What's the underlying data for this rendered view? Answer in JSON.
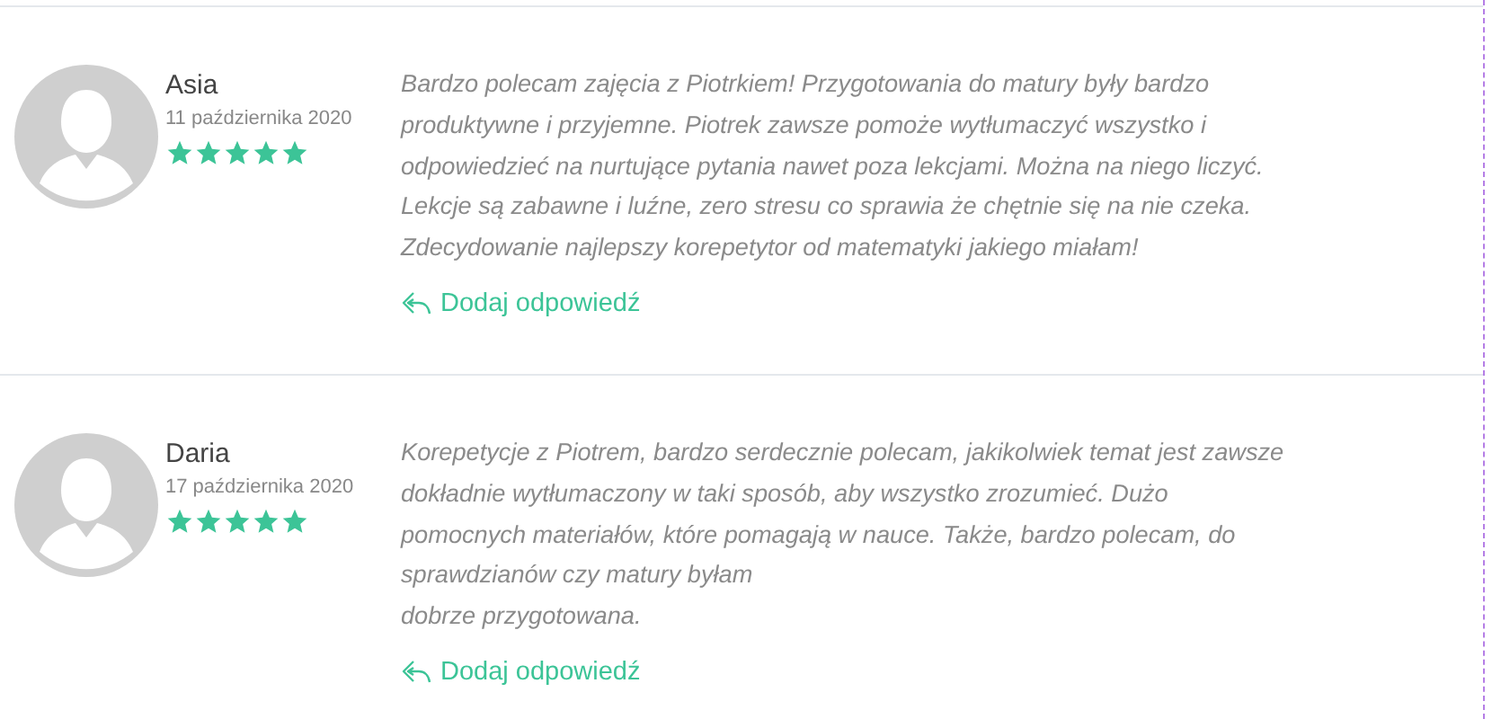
{
  "reviews": [
    {
      "name": "Asia",
      "date": "11 października 2020",
      "stars": 5,
      "text": "Bardzo polecam zajęcia z Piotrkiem! Przygotowania do matury były bardzo\nproduktywne i przyjemne. Piotrek zawsze pomoże wytłumaczyć wszystko i\nodpowiedzieć na nurtujące pytania nawet poza lekcjami. Można na niego liczyć.\nLekcje są zabawne i luźne, zero stresu co sprawia że chętnie się na nie czeka.\nZdecydowanie najlepszy korepetytor od matematyki jakiego miałam!",
      "reply": "Dodaj odpowiedź"
    },
    {
      "name": "Daria",
      "date": "17 października 2020",
      "stars": 5,
      "text": "Korepetycje z Piotrem, bardzo serdecznie polecam, jakikolwiek temat jest zawsze\ndokładnie wytłumaczony w taki sposób, aby wszystko zrozumieć. Dużo\npomocnych materiałów, które pomagają w nauce. Także, bardzo polecam, do\nsprawdzianów czy matury byłam\ndobrze przygotowana.",
      "reply": "Dodaj odpowiedź"
    }
  ]
}
